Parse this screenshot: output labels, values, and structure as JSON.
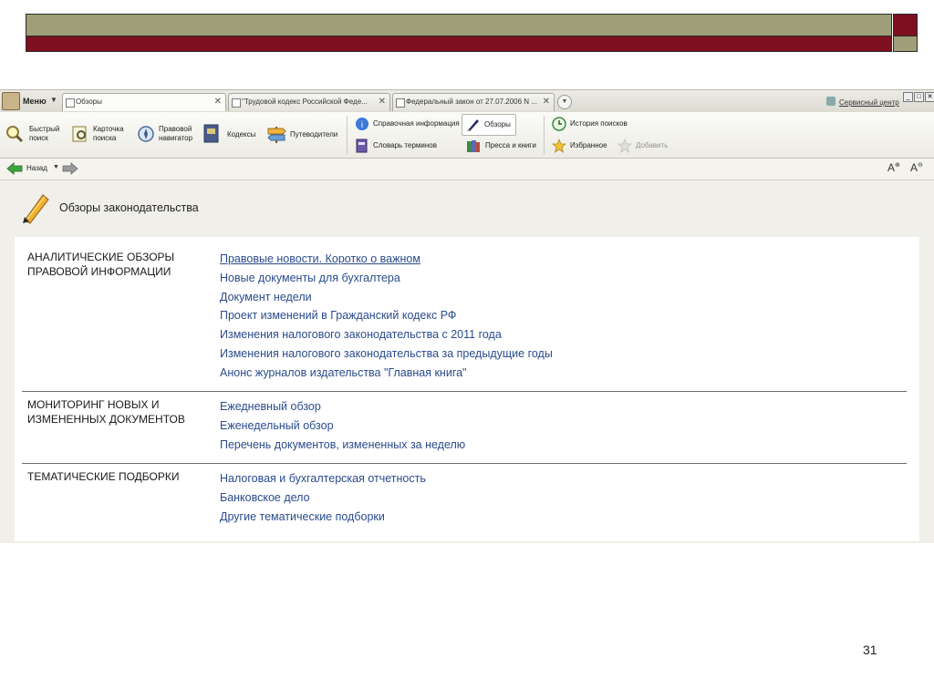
{
  "slide": {
    "colors": {
      "olive": "#9e9f78",
      "dark_red": "#7d0f1f"
    },
    "page_number": "31"
  },
  "app": {
    "menu_label": "Меню",
    "tabs": [
      {
        "label": "Обзоры",
        "active": true
      },
      {
        "label": "\"Трудовой кодекс Российской Феде...",
        "active": false
      },
      {
        "label": "Федеральный закон от 27.07.2006 N ...",
        "active": false
      }
    ],
    "service_center": "Сервисный центр",
    "toolbar": {
      "quick_search": [
        "Быстрый",
        "поиск"
      ],
      "search_card": [
        "Карточка",
        "поиска"
      ],
      "legal_navigator": [
        "Правовой",
        "навигатор"
      ],
      "codes": "Кодексы",
      "guides": "Путеводители",
      "reference_info": "Справочная информация",
      "reviews": "Обзоры",
      "dictionary": "Словарь терминов",
      "press_books": "Пресса и книги",
      "search_history": "История поисков",
      "favorites": "Избранное",
      "add": "Добавить"
    },
    "nav": {
      "back": "Назад"
    },
    "page_title": "Обзоры законодательства",
    "sections": [
      {
        "title": [
          "АНАЛИТИЧЕСКИЕ ОБЗОРЫ",
          "ПРАВОВОЙ ИНФОРМАЦИИ"
        ],
        "links": [
          "Правовые новости. Коротко о важном",
          "Новые документы для бухгалтера",
          "Документ недели",
          "Проект изменений в Гражданский кодекс РФ",
          "Изменения налогового законодательства с 2011 года",
          "Изменения налогового законодательства за предыдущие годы",
          "Анонс журналов издательства \"Главная книга\""
        ]
      },
      {
        "title": [
          "МОНИТОРИНГ НОВЫХ И",
          "ИЗМЕНЕННЫХ ДОКУМЕНТОВ"
        ],
        "links": [
          "Ежедневный обзор",
          "Еженедельный обзор",
          "Перечень документов, измененных за неделю"
        ]
      },
      {
        "title": [
          "ТЕМАТИЧЕСКИЕ ПОДБОРКИ"
        ],
        "links": [
          "Налоговая и бухгалтерская отчетность",
          "Банковское дело",
          "Другие тематические подборки"
        ]
      }
    ]
  }
}
